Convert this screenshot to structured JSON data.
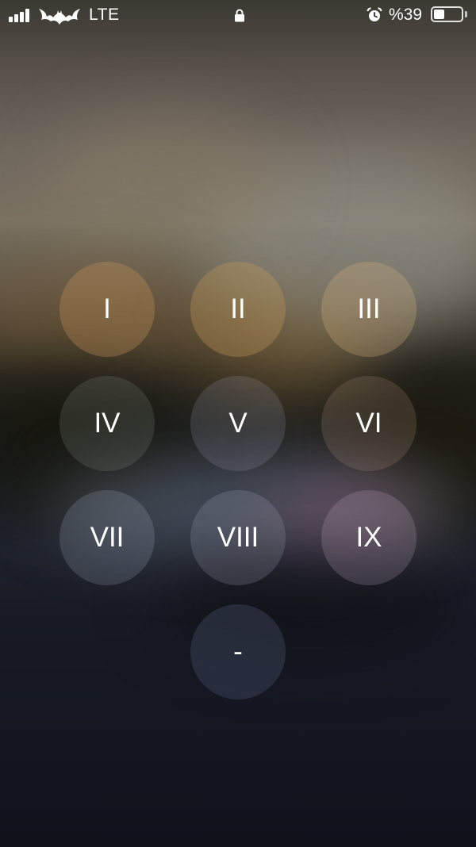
{
  "status_bar": {
    "carrier_logo_icon": "bat-logo-icon",
    "network": "LTE",
    "lock_icon": "lock-icon",
    "alarm_icon": "alarm-clock-icon",
    "battery_percent": "%39",
    "battery_level": 0.39
  },
  "keypad": {
    "keys": [
      {
        "label": "I"
      },
      {
        "label": "II"
      },
      {
        "label": "III"
      },
      {
        "label": "IV"
      },
      {
        "label": "V"
      },
      {
        "label": "VI"
      },
      {
        "label": "VII"
      },
      {
        "label": "VIII"
      },
      {
        "label": "IX"
      },
      {
        "label": "-"
      }
    ]
  }
}
